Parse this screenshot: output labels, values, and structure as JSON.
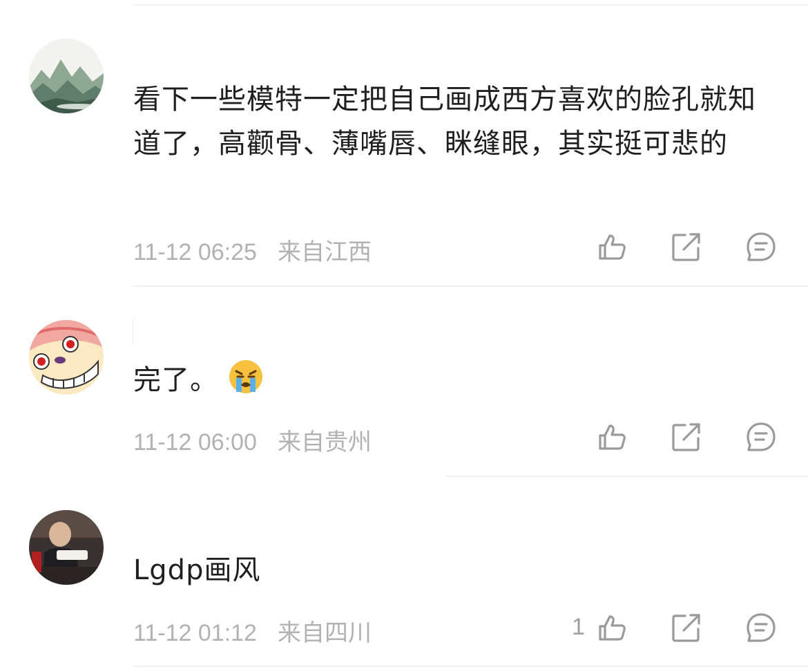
{
  "comments": [
    {
      "text": "看下一些模特一定把自己画成西方喜欢的脸孔就知道了，高颧骨、薄嘴唇、眯缝眼，其实挺可悲的",
      "time": "11-12 06:25",
      "location": "来自江西",
      "like_count": ""
    },
    {
      "text": "完了。",
      "emoji": "crying-face",
      "time": "11-12 06:00",
      "location": "来自贵州",
      "like_count": ""
    },
    {
      "text": "Lgdp画风",
      "time": "11-12 01:12",
      "location": "来自四川",
      "like_count": "1"
    }
  ],
  "colors": {
    "meta": "#b2b2b2",
    "icon": "#9a9a9a",
    "divider": "#f0f0f0"
  }
}
